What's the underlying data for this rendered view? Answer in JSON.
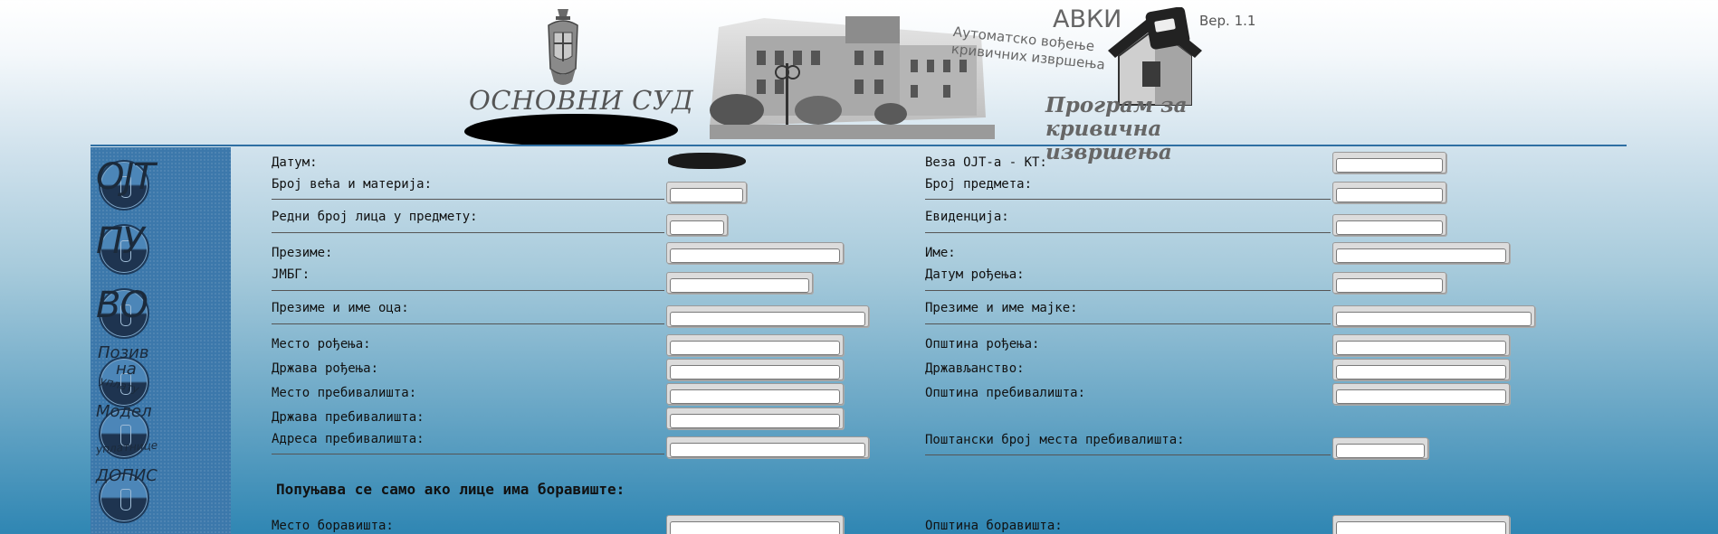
{
  "header": {
    "court_name": "ОСНОВНИ СУД",
    "app_title": "АВКИ",
    "app_subtitle": "Аутоматско вођење\nкривичних извршења",
    "version": "Вер. 1.1",
    "program_title": "Програм за кривична\nизвршења"
  },
  "sidebar": {
    "items": [
      {
        "label": "ОЈТ"
      },
      {
        "label": "ПУ"
      },
      {
        "label": "ВО"
      },
      {
        "label": "Позив",
        "label2": "на",
        "sub": "уплату"
      },
      {
        "label": "Модел",
        "sub": "уплатнице"
      },
      {
        "label": "ДОПИС"
      }
    ]
  },
  "form": {
    "left": {
      "date_label": "Датум:",
      "chamber_label": "Број већа и материја:",
      "ordinal_label": "Редни број лица у предмету:",
      "surname_label": "Презиме:",
      "jmbg_label": "ЈМБГ:",
      "father_label": "Презиме и име оца:",
      "birthplace_label": "Место рођења:",
      "birth_country_label": "Држава рођења:",
      "residence_place_label": "Место пребивалишта:",
      "residence_country_label": "Држава пребивалишта:",
      "address_label": "Адреса пребивалишта:",
      "stay_place_label": "Место боравишта:"
    },
    "right": {
      "ojt_label": "Веза ОЈТ-а - КТ:",
      "case_number_label": "Број предмета:",
      "registry_label": "Евиденција:",
      "name_label": "Име:",
      "dob_label": "Датум рођења:",
      "mother_label": "Презиме и име мајке:",
      "birth_municipality_label": "Општина рођења:",
      "citizenship_label": "Држављанство:",
      "residence_municipality_label": "Општина пребивалишта:",
      "postal_code_label": "Поштански број места пребивалишта:",
      "stay_municipality_label": "Општина боравишта:"
    },
    "section_heading": "Попуњава се само ако лице има боравиште:"
  }
}
